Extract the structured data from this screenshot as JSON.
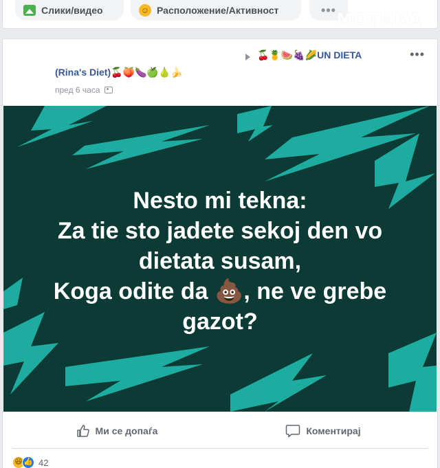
{
  "composer": {
    "photo_label": "Слики/видео",
    "location_label": "Расположение/Активност",
    "more_label": "•••",
    "icons": {
      "photo": "photo-icon",
      "location": "smile-icon",
      "more": "more-dots-icon"
    }
  },
  "watermark": "МОТИКА",
  "post": {
    "author": "(Rina's Diet)",
    "author_emoji": "🍒🍑🍆🍏🍐🍌",
    "group_emoji": "🍒🍍🍉🍇🌽",
    "group_name": "UN DIETA",
    "timestamp": "пред 6 часа",
    "menu_label": "•••",
    "image": {
      "background_color": "#0c3b35",
      "accent_color": "#1fb3a6",
      "lines": [
        "Nesto mi tekna:",
        "Za tie sto jadete sekoj den vo",
        "dietata susam,",
        "Koga odite da 💩, ne ve grebe",
        "gazot?"
      ]
    },
    "actions": {
      "like_label": "Ми се допаѓа",
      "comment_label": "Коментирај"
    },
    "reactions": {
      "icons": [
        "haha-icon",
        "like-icon"
      ],
      "count": "42"
    }
  },
  "colors": {
    "link_blue": "#365899",
    "page_bg": "#e9ebee",
    "secondary_text": "#90949c"
  }
}
